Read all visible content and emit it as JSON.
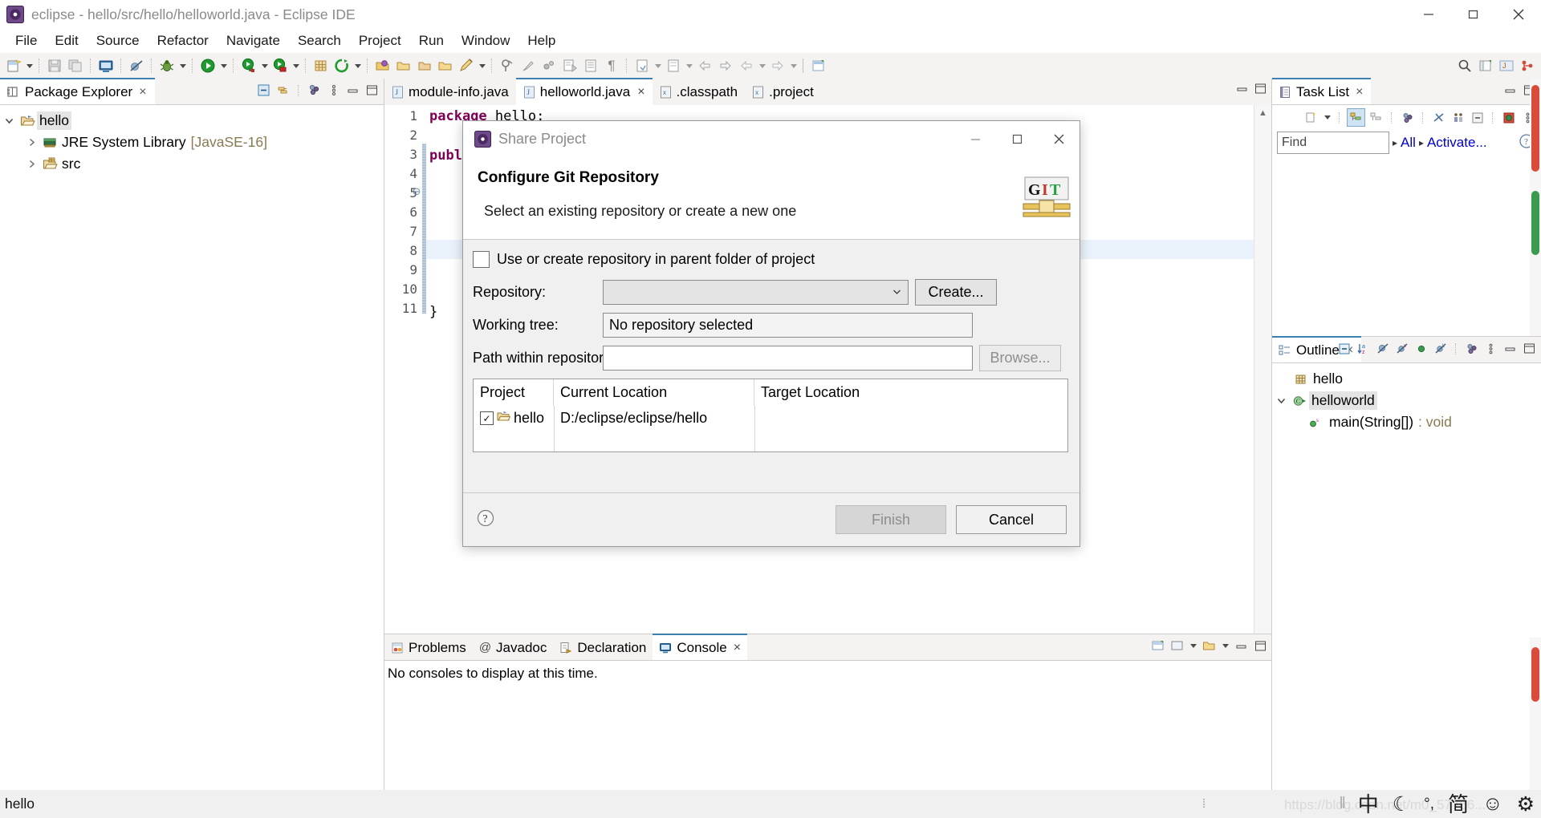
{
  "window": {
    "title": "eclipse - hello/src/hello/helloworld.java - Eclipse IDE",
    "minimize": "—",
    "maximize": "❐",
    "close": "✕"
  },
  "menubar": {
    "items": [
      "File",
      "Edit",
      "Source",
      "Refactor",
      "Navigate",
      "Search",
      "Project",
      "Run",
      "Window",
      "Help"
    ]
  },
  "package_explorer": {
    "title": "Package Explorer",
    "close": "×",
    "tree": [
      {
        "label": "hello",
        "dim": "",
        "indent": 0,
        "arrow": "down",
        "icon": "project-folder-icon",
        "selected": true
      },
      {
        "label": "JRE System Library",
        "dim": "[JavaSE-16]",
        "indent": 1,
        "arrow": "right",
        "icon": "library-icon",
        "selected": false
      },
      {
        "label": "src",
        "dim": "",
        "indent": 1,
        "arrow": "right",
        "icon": "source-folder-icon",
        "selected": false
      }
    ]
  },
  "editor": {
    "tabs": [
      {
        "label": "module-info.java",
        "icon": "java-file-icon",
        "active": false,
        "closable": false
      },
      {
        "label": "helloworld.java",
        "icon": "java-file-icon",
        "active": true,
        "closable": true
      },
      {
        "label": ".classpath",
        "icon": "xml-file-icon",
        "active": false,
        "closable": false
      },
      {
        "label": ".project",
        "icon": "xml-file-icon",
        "active": false,
        "closable": false
      }
    ],
    "close_glyph": "×",
    "line_numbers": [
      "1",
      "2",
      "3",
      "4",
      "5",
      "6",
      "7",
      "8",
      "9",
      "10",
      "11"
    ],
    "lines": [
      {
        "n": 1,
        "segments": [
          {
            "t": "package",
            "kw": true
          },
          {
            "t": " hello;",
            "kw": false
          }
        ]
      },
      {
        "n": 2,
        "segments": []
      },
      {
        "n": 3,
        "segments": [
          {
            "t": "publ",
            "kw": true
          }
        ]
      },
      {
        "n": 4,
        "segments": []
      },
      {
        "n": 5,
        "segments": []
      },
      {
        "n": 6,
        "segments": []
      },
      {
        "n": 7,
        "segments": []
      },
      {
        "n": 8,
        "segments": []
      },
      {
        "n": 9,
        "segments": []
      },
      {
        "n": 10,
        "segments": [
          {
            "t": "}",
            "kw": false
          }
        ]
      },
      {
        "n": 11,
        "segments": []
      }
    ],
    "fold_marker_line": 5,
    "current_line": 8
  },
  "bottom_panel": {
    "tabs": [
      {
        "label": "Problems",
        "icon": "problems-icon",
        "active": false,
        "closable": false
      },
      {
        "label": "Javadoc",
        "icon": "javadoc-icon",
        "active": false,
        "closable": false
      },
      {
        "label": "Declaration",
        "icon": "declaration-icon",
        "active": false,
        "closable": false
      },
      {
        "label": "Console",
        "icon": "console-icon",
        "active": true,
        "closable": true
      }
    ],
    "close_glyph": "×",
    "content": "No consoles to display at this time."
  },
  "task_list": {
    "title": "Task List",
    "close": "×",
    "find_placeholder": "Find",
    "crumb_all": "All",
    "crumb_activate": "Activate...",
    "crumb_sep": "▸",
    "help": "?"
  },
  "outline": {
    "title": "Outline",
    "close": "×",
    "items": [
      {
        "label": "helloworld",
        "suffix": "",
        "indent": 0,
        "arrow": "down",
        "icon": "class-icon",
        "selected": true
      },
      {
        "label": "main(String[])",
        "suffix": " : void",
        "indent": 1,
        "arrow": "none",
        "icon": "method-public-static-icon",
        "selected": false
      }
    ],
    "package_item": {
      "label": "hello",
      "icon": "package-icon"
    }
  },
  "dialog": {
    "title": "Share Project",
    "minimize": "—",
    "maximize": "❐",
    "close": "✕",
    "heading": "Configure Git Repository",
    "subheading": "Select an existing repository or create a new one",
    "logo_text": "GIT",
    "checkbox_label": "Use or create repository in parent folder of project",
    "checkbox_checked": false,
    "fields": [
      {
        "label": "Repository:",
        "value": "",
        "kind": "combo",
        "button": "Create...",
        "button_disabled": false
      },
      {
        "label": "Working tree:",
        "value": "No repository selected",
        "kind": "readonly",
        "button": "",
        "button_disabled": false
      },
      {
        "label": "Path within repository:",
        "value": "",
        "kind": "text",
        "button": "Browse...",
        "button_disabled": true
      }
    ],
    "table": {
      "headers": [
        "Project",
        "Current Location",
        "Target Location"
      ],
      "rows": [
        {
          "checked": true,
          "project": "hello",
          "current_location": "D:/eclipse/eclipse/hello",
          "target_location": ""
        }
      ]
    },
    "help_glyph": "?",
    "buttons": [
      {
        "label": "Finish",
        "disabled": true
      },
      {
        "label": "Cancel",
        "disabled": false
      }
    ]
  },
  "statusbar": {
    "text": "hello",
    "ime": [
      {
        "name": "ime-separator",
        "glyph": "‖"
      },
      {
        "name": "ime-chinese-mode",
        "glyph": "中"
      },
      {
        "name": "ime-moon-icon",
        "glyph": "☾"
      },
      {
        "name": "ime-punctuation-icon",
        "glyph": "°,"
      },
      {
        "name": "ime-simplified-icon",
        "glyph": "简"
      },
      {
        "name": "ime-emoji-icon",
        "glyph": "☺"
      },
      {
        "name": "ime-settings-icon",
        "glyph": "⚙"
      }
    ],
    "watermark": "https://blog.csdn.net/m0_57766..."
  },
  "colors": {
    "accent": "#3c7fb1",
    "link": "#0000cc",
    "keyword": "#7f0055",
    "dim_text": "#8a7a52"
  }
}
